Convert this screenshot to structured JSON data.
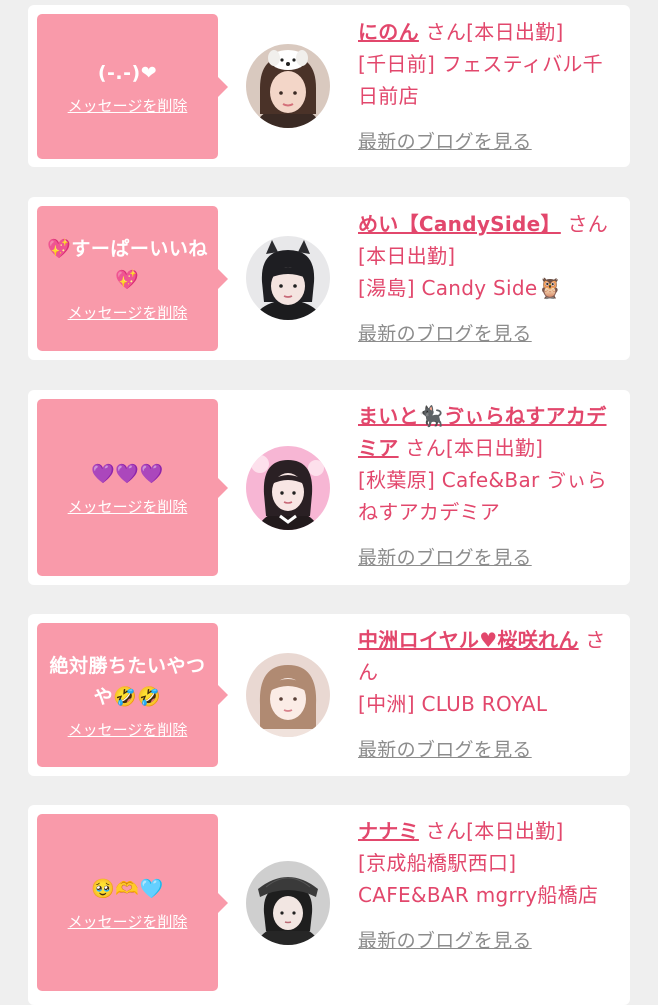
{
  "messages": [
    {
      "text": "(-.-)❤",
      "delete_label": "メッセージを削除",
      "cast_name": "にのん",
      "san": " さん",
      "status": "[本日出勤]",
      "area": "[千日前]",
      "shop": " フェスティバル千日前店",
      "blog_label": "最新のブログを見る"
    },
    {
      "text": "💖すーぱーいいね💖",
      "delete_label": "メッセージを削除",
      "cast_name": "めい【CandySide】",
      "san": " さん",
      "status": "[本日出勤]",
      "area": "[湯島]",
      "shop": " Candy Side🦉",
      "blog_label": "最新のブログを見る"
    },
    {
      "text": "💜💜💜",
      "delete_label": "メッセージを削除",
      "cast_name": "まいと🐈‍⬛ゔぃらねすアカデミア",
      "san": " さん",
      "status": "[本日出勤]",
      "area": "[秋葉原]",
      "shop": " Cafe&Bar ゔぃらねすアカデミア",
      "blog_label": "最新のブログを見る"
    },
    {
      "text": "絶対勝ちたいやつや🤣🤣",
      "delete_label": "メッセージを削除",
      "cast_name": "中洲ロイヤル♥桜咲れん",
      "san": " さん",
      "status": "",
      "area": "[中洲]",
      "shop": " CLUB ROYAL",
      "blog_label": "最新のブログを見る"
    },
    {
      "text": "🥹🫶🩵",
      "delete_label": "メッセージを削除",
      "cast_name": "ナナミ",
      "san": " さん",
      "status": "[本日出勤]",
      "area": "[京成船橋駅西口]",
      "shop": " CAFE&BAR mgrry船橋店",
      "blog_label": "最新のブログを見る"
    }
  ],
  "colors": {
    "accent": "#e2476c",
    "bubble": "#f99aaa",
    "link_gray": "#8c8c8c",
    "page_bg": "#efefef"
  }
}
